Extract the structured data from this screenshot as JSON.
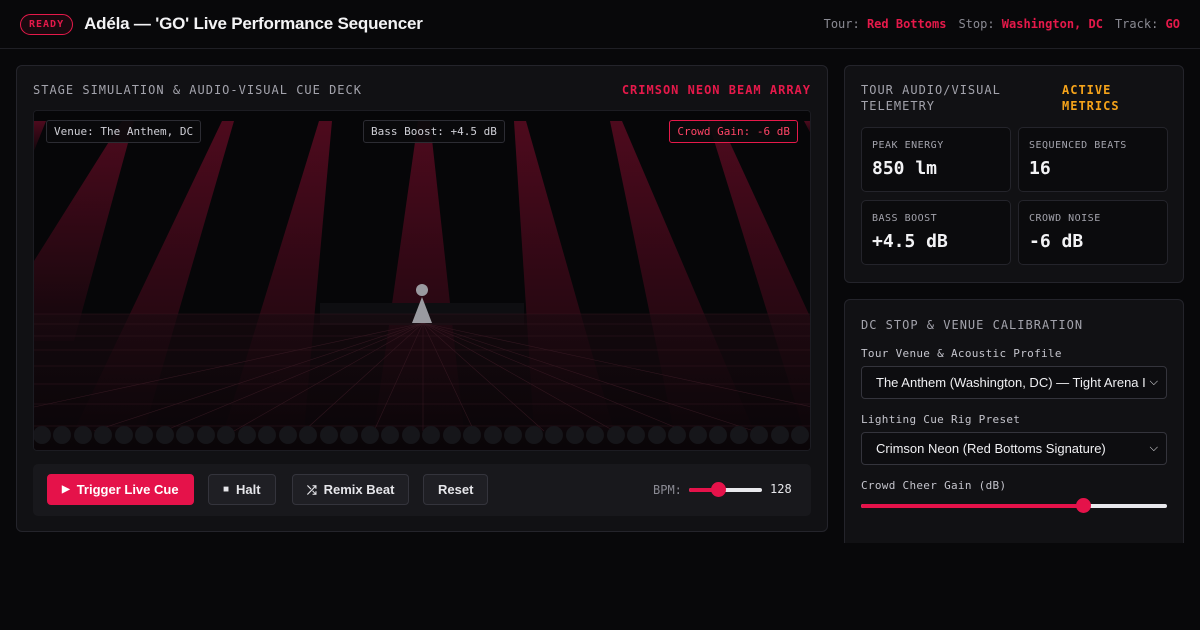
{
  "header": {
    "status_badge": "READY",
    "title": "Adéla — 'GO' Live Performance Sequencer",
    "meta": [
      {
        "key": "Tour:",
        "value": "Red Bottoms"
      },
      {
        "key": "Stop:",
        "value": "Washington, DC"
      },
      {
        "key": "Track:",
        "value": "GO"
      }
    ]
  },
  "stage_panel": {
    "title": "STAGE SIMULATION & AUDIO-VISUAL CUE DECK",
    "accent": "CRIMSON NEON BEAM ARRAY",
    "overlay": {
      "venue": "Venue: The Anthem, DC",
      "bass": "Bass Boost: +4.5 dB",
      "crowd": "Crowd Gain: -6 dB"
    },
    "controls": {
      "trigger": "Trigger Live Cue",
      "halt": "Halt",
      "remix": "Remix Beat",
      "reset": "Reset",
      "bpm_label": "BPM:",
      "bpm_value": "128",
      "bpm_fraction": 0.38
    }
  },
  "telemetry": {
    "title": "TOUR AUDIO/VISUAL TELEMETRY",
    "accent": "ACTIVE METRICS",
    "metrics": [
      {
        "label": "PEAK ENERGY",
        "value": "850 lm"
      },
      {
        "label": "SEQUENCED BEATS",
        "value": "16"
      },
      {
        "label": "BASS BOOST",
        "value": "+4.5 dB"
      },
      {
        "label": "CROWD NOISE",
        "value": "-6 dB"
      }
    ]
  },
  "calibration": {
    "title": "DC STOP & VENUE CALIBRATION",
    "venue_label": "Tour Venue & Acoustic Profile",
    "venue_value": "The Anthem (Washington, DC) — Tight Arena I",
    "rig_label": "Lighting Cue Rig Preset",
    "rig_value": "Crimson Neon (Red Bottoms Signature)",
    "cheer_label": "Crowd Cheer Gain (dB)",
    "cheer_fraction": 0.74
  },
  "colors": {
    "accent": "#e5124a",
    "amber": "#f5a31a",
    "background": "#08080a",
    "panel": "#111114"
  },
  "icons": {
    "trigger": "play-icon",
    "halt": "stop-icon",
    "remix": "shuffle-icon",
    "select": "chevron-down-icon"
  }
}
